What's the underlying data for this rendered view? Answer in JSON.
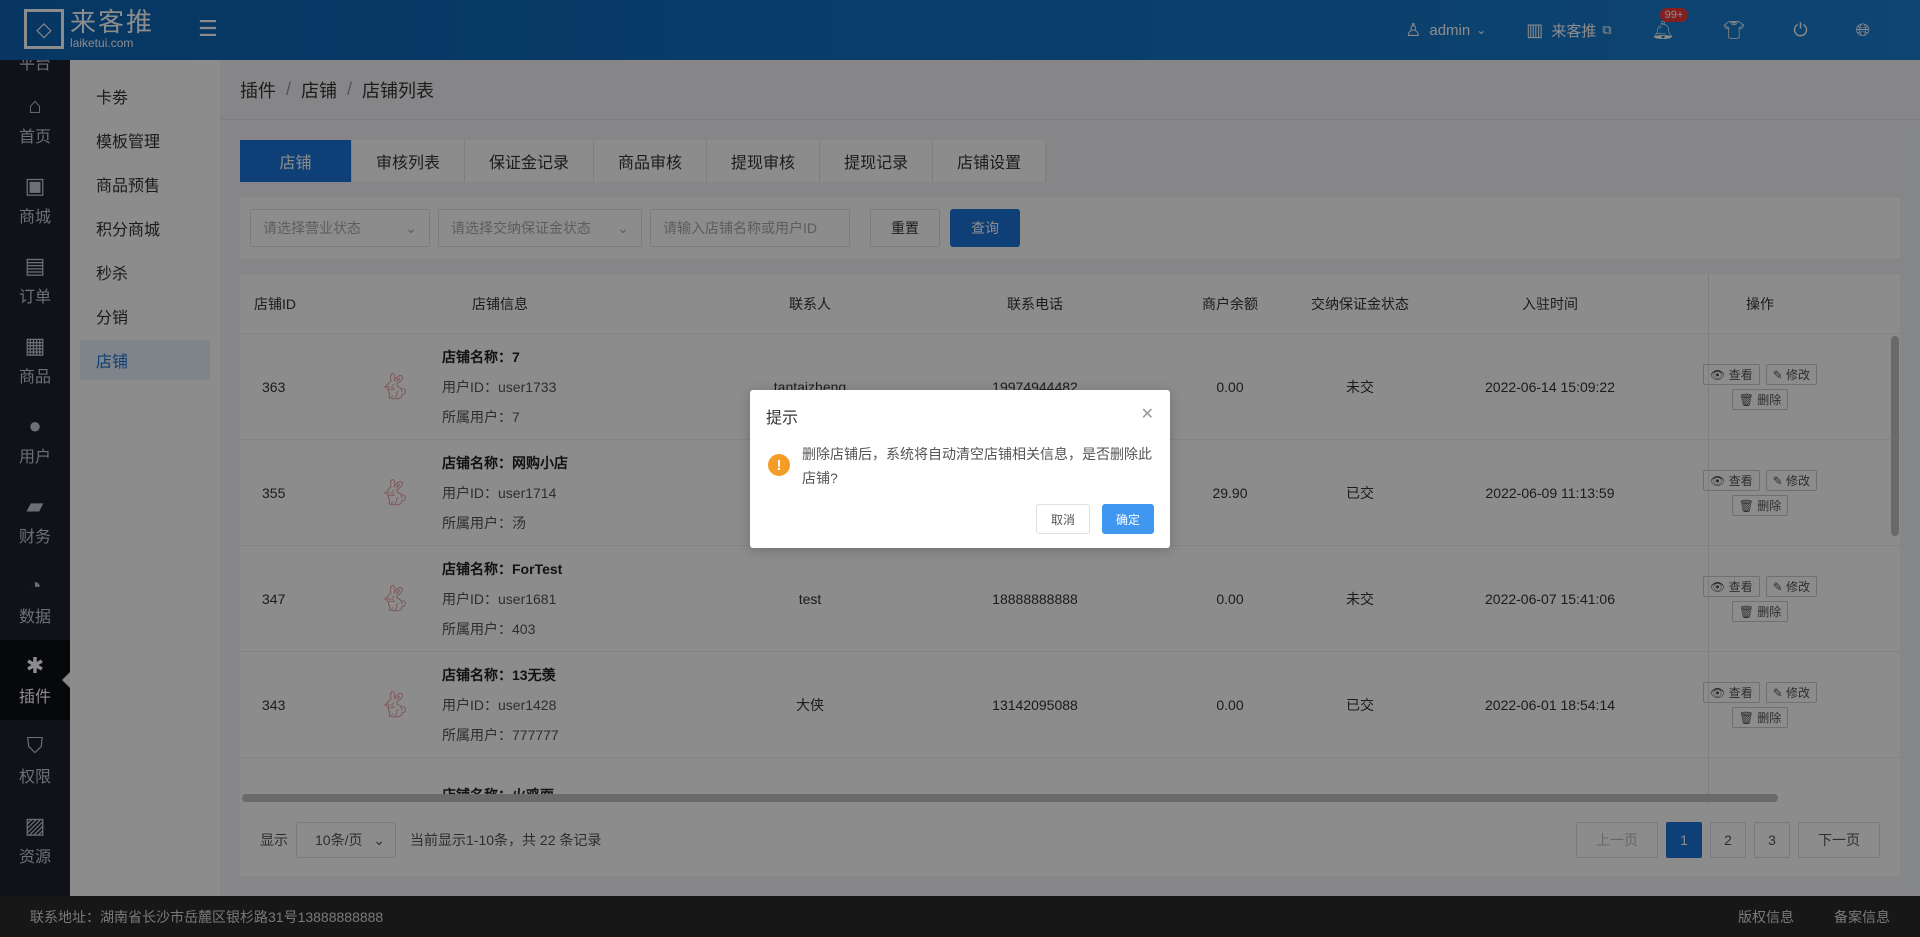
{
  "header": {
    "logo_cn": "来客推",
    "logo_en": "laiketui.com",
    "user": "admin",
    "store_link": "来客推",
    "notification_badge": "99+"
  },
  "icon_nav": {
    "top_partial": "平台",
    "items": [
      {
        "label": "首页",
        "icon": "⌂"
      },
      {
        "label": "商城",
        "icon": "▣"
      },
      {
        "label": "订单",
        "icon": "▤"
      },
      {
        "label": "商品",
        "icon": "▦"
      },
      {
        "label": "用户",
        "icon": "●"
      },
      {
        "label": "财务",
        "icon": "▰"
      },
      {
        "label": "数据",
        "icon": "◔"
      },
      {
        "label": "插件",
        "icon": "✱"
      },
      {
        "label": "权限",
        "icon": "⛉"
      },
      {
        "label": "资源",
        "icon": "▨"
      }
    ]
  },
  "sub_nav": {
    "items": [
      "卡劵",
      "模板管理",
      "商品预售",
      "积分商城",
      "秒杀",
      "分销",
      "店铺"
    ]
  },
  "breadcrumb": [
    "插件",
    "店铺",
    "店铺列表"
  ],
  "tabs": [
    "店铺",
    "审核列表",
    "保证金记录",
    "商品审核",
    "提现审核",
    "提现记录",
    "店铺设置"
  ],
  "filters": {
    "status_placeholder": "请选择营业状态",
    "deposit_placeholder": "请选择交纳保证金状态",
    "search_placeholder": "请输入店铺名称或用户ID",
    "reset_label": "重置",
    "query_label": "查询"
  },
  "table": {
    "headers": [
      "店铺ID",
      "店铺信息",
      "联系人",
      "联系电话",
      "商户余额",
      "交纳保证金状态",
      "入驻时间",
      "操作"
    ],
    "rows": [
      {
        "id": "363",
        "name": "店铺名称：7",
        "uid": "用户ID：user1733",
        "owner": "所属用户：7",
        "contact": "tantaizheng",
        "phone": "19974944482",
        "balance": "0.00",
        "deposit": "未交",
        "time": "2022-06-14 15:09:22"
      },
      {
        "id": "355",
        "name": "店铺名称：网购小店",
        "uid": "用户ID：user1714",
        "owner": "所属用户：汤",
        "contact": "",
        "phone": "",
        "balance": "29.90",
        "deposit": "已交",
        "time": "2022-06-09 11:13:59"
      },
      {
        "id": "347",
        "name": "店铺名称：ForTest",
        "uid": "用户ID：user1681",
        "owner": "所属用户：403",
        "contact": "test",
        "phone": "18888888888",
        "balance": "0.00",
        "deposit": "未交",
        "time": "2022-06-07 15:41:06"
      },
      {
        "id": "343",
        "name": "店铺名称：13无羡",
        "uid": "用户ID：user1428",
        "owner": "所属用户：777777",
        "contact": "大侠",
        "phone": "13142095088",
        "balance": "0.00",
        "deposit": "已交",
        "time": "2022-06-01 18:54:14"
      },
      {
        "id": "",
        "name": "店铺名称：火鸡面",
        "uid": "",
        "owner": "",
        "contact": "",
        "phone": "",
        "balance": "",
        "deposit": "",
        "time": ""
      }
    ],
    "op_view": "查看",
    "op_edit": "修改",
    "op_delete": "删除"
  },
  "pager": {
    "show_label": "显示",
    "page_size": "10条/页",
    "summary": "当前显示1-10条，共 22 条记录",
    "prev": "上一页",
    "pages": [
      "1",
      "2",
      "3"
    ],
    "next": "下一页"
  },
  "footer": {
    "address": "联系地址：湖南省长沙市岳麓区银杉路31号13888888888",
    "copyright": "版权信息",
    "record": "备案信息"
  },
  "dialog": {
    "title": "提示",
    "message": "删除店铺后，系统将自动清空店铺相关信息，是否删除此店铺?",
    "cancel": "取消",
    "confirm": "确定"
  }
}
